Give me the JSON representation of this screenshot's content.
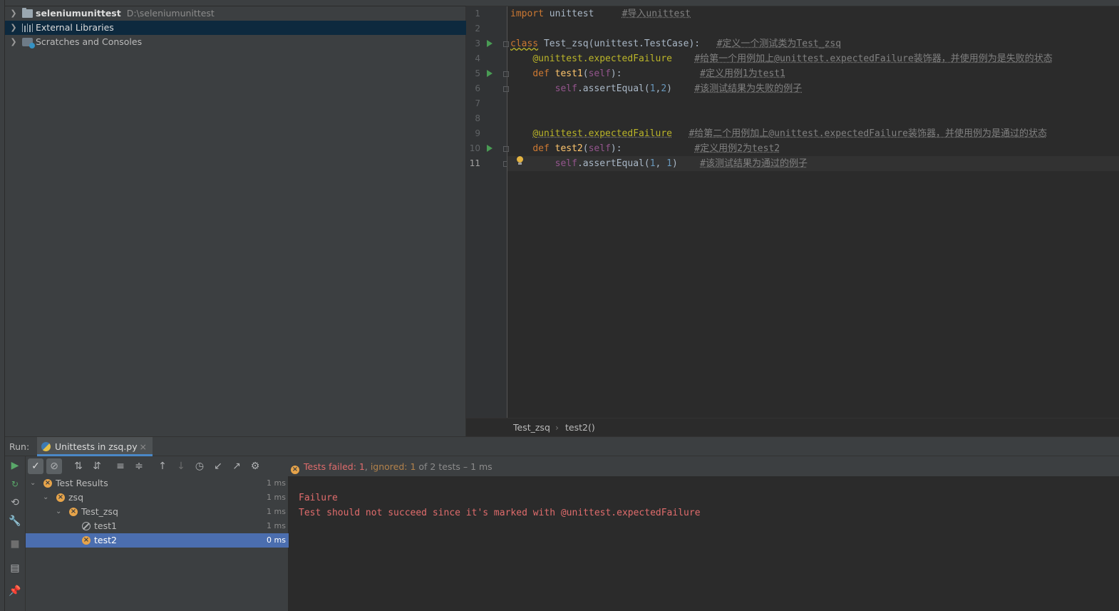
{
  "project": {
    "items": [
      {
        "label": "seleniumunittest",
        "path": "D:\\seleniumunittest",
        "icon": "folder-icon"
      },
      {
        "label": "External Libraries",
        "icon": "library-icon"
      },
      {
        "label": "Scratches and Consoles",
        "icon": "scratch-icon"
      }
    ]
  },
  "editor": {
    "line_numbers": [
      "1",
      "2",
      "3",
      "4",
      "5",
      "6",
      "7",
      "8",
      "9",
      "10",
      "11"
    ],
    "current_line": "11",
    "code": {
      "l1": {
        "kw": "import",
        "mod": " unittest",
        "cmt": "#导入unittest"
      },
      "l3": {
        "kw": "class",
        "name": " Test_zsq(unittest.TestCase):",
        "cmt": "#定义一个测试类为Test_zsq"
      },
      "l4": {
        "dec": "@unittest.expectedFailure",
        "cmt": "#给第一个用例加上@unittest.expectedFailure装饰器，并使用例为是失败的状态"
      },
      "l5": {
        "kw": "def",
        "fn": "test1",
        "args_open": "(",
        "self": "self",
        "args_close": "):",
        "cmt": "#定义用例1为test1"
      },
      "l6": {
        "self": "self",
        "call": ".assertEqual(",
        "n1": "1",
        "sep": ",",
        "n2": "2",
        "close": ")",
        "cmt": "#该测试结果为失败的例子"
      },
      "l9": {
        "dec": "@unittest.expectedFailure",
        "cmt": "#给第二个用例加上@unittest.expectedFailure装饰器，并使用例为是通过的状态"
      },
      "l10": {
        "kw": "def",
        "fn": "test2",
        "args_open": "(",
        "self": "self",
        "args_close": "):",
        "cmt": "#定义用例2为test2"
      },
      "l11": {
        "self": "self",
        "call": ".assertEqual(",
        "n1": "1",
        "sep": ", ",
        "n2": "1",
        "close": ")",
        "cmt": "#该测试结果为通过的例子"
      }
    },
    "breadcrumb": [
      "Test_zsq",
      "test2()"
    ]
  },
  "run": {
    "label": "Run:",
    "tab_label": "Unittests in zsq.py",
    "status": {
      "failed": "Tests failed: 1",
      "sep": ", ",
      "ignored": "ignored: 1",
      "rest": " of 2 tests – 1 ms"
    },
    "tree": [
      {
        "label": "Test Results",
        "time": "1 ms"
      },
      {
        "label": "zsq",
        "time": "1 ms"
      },
      {
        "label": "Test_zsq",
        "time": "1 ms"
      },
      {
        "label": "test1",
        "time": "1 ms"
      },
      {
        "label": "test2",
        "time": "0 ms"
      }
    ],
    "console": [
      "Failure",
      "Test should not succeed since it's marked with @unittest.expectedFailure"
    ]
  },
  "colors": {
    "accent": "#4a88c7",
    "selection": "#4b6eaf",
    "error": "#e06c6c",
    "warning": "#e7a44a"
  }
}
